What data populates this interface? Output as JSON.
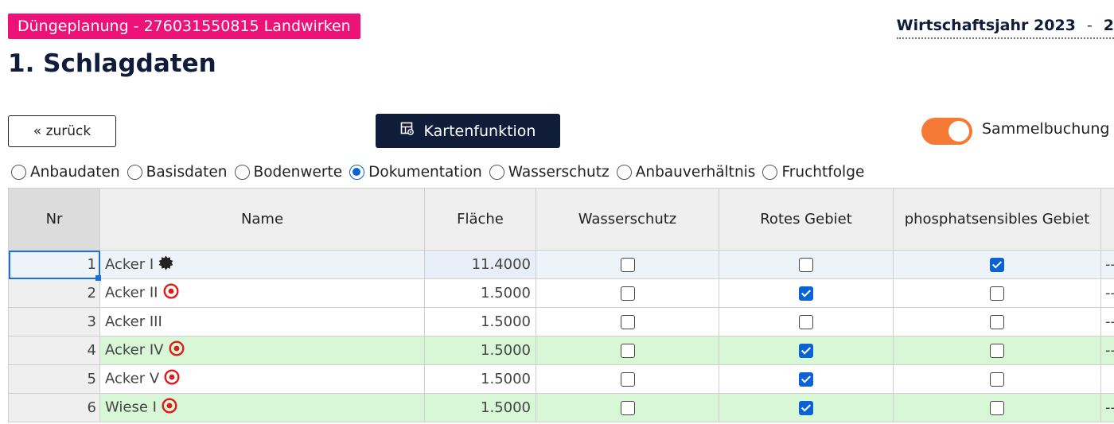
{
  "header": {
    "badge": "Düngeplanung - 276031550815 Landwirken",
    "year_label": "Wirtschaftsjahr 2023",
    "year_dash": "-",
    "year_cut": "2"
  },
  "page_title": "1. Schlagdaten",
  "toolbar": {
    "back_label": "« zurück",
    "map_label": "Kartenfunktion",
    "toggle_label": "Sammelbuchung",
    "toggle_on": true
  },
  "radios": [
    {
      "label": "Anbaudaten",
      "selected": false
    },
    {
      "label": "Basisdaten",
      "selected": false
    },
    {
      "label": "Bodenwerte",
      "selected": false
    },
    {
      "label": "Dokumentation",
      "selected": true
    },
    {
      "label": "Wasserschutz",
      "selected": false
    },
    {
      "label": "Anbauverhältnis",
      "selected": false
    },
    {
      "label": "Fruchtfolge",
      "selected": false
    }
  ],
  "table": {
    "columns": [
      "Nr",
      "Name",
      "Fläche",
      "Wasserschutz",
      "Rotes Gebiet",
      "phosphatsensibles Gebiet"
    ],
    "rows": [
      {
        "nr": "1",
        "name": "Acker I",
        "icon": "gear-badge-icon",
        "flaeche": "11.4000",
        "wasserschutz": false,
        "rotes": false,
        "phosphat": true,
        "extra": "---"
      },
      {
        "nr": "2",
        "name": "Acker II",
        "icon": "target-icon",
        "flaeche": "1.5000",
        "wasserschutz": false,
        "rotes": true,
        "phosphat": false,
        "extra": "---"
      },
      {
        "nr": "3",
        "name": "Acker III",
        "icon": "",
        "flaeche": "1.5000",
        "wasserschutz": false,
        "rotes": false,
        "phosphat": false,
        "extra": "---"
      },
      {
        "nr": "4",
        "name": "Acker IV",
        "icon": "target-icon",
        "flaeche": "1.5000",
        "wasserschutz": false,
        "rotes": true,
        "phosphat": false,
        "extra": "---"
      },
      {
        "nr": "5",
        "name": "Acker V",
        "icon": "target-icon",
        "flaeche": "1.5000",
        "wasserschutz": false,
        "rotes": true,
        "phosphat": false,
        "extra": ""
      },
      {
        "nr": "6",
        "name": "Wiese I",
        "icon": "target-icon",
        "flaeche": "1.5000",
        "wasserschutz": false,
        "rotes": true,
        "phosphat": false,
        "extra": "---"
      }
    ]
  },
  "colors": {
    "badge": "#ee1177",
    "navy": "#0f1c3a",
    "toggle": "#f47a36",
    "check": "#0a62d4",
    "green_row": "#d7f7d7",
    "target_red": "#e01b1b"
  }
}
